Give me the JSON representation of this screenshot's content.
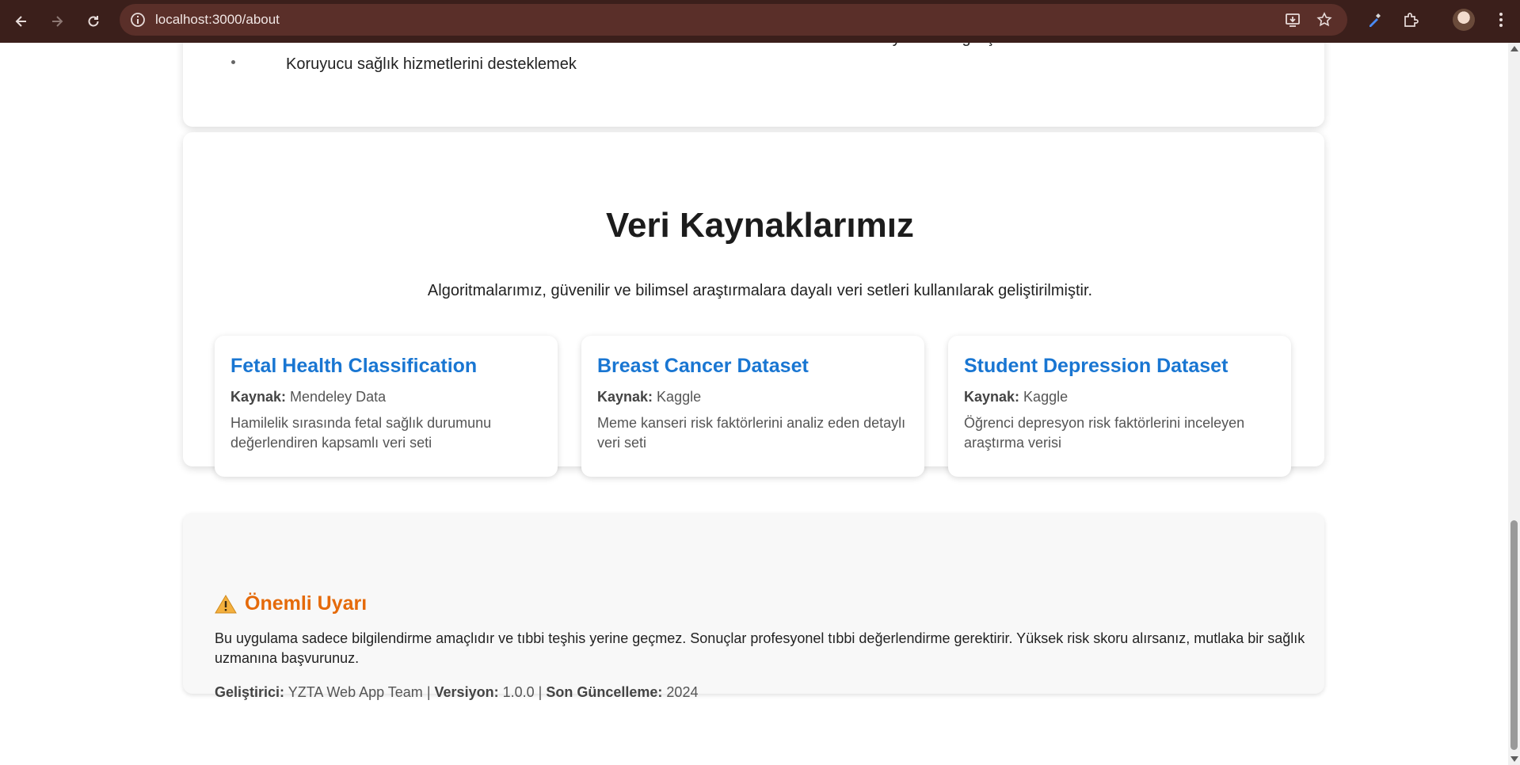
{
  "browser": {
    "url": "localhost:3000/about"
  },
  "top_card": {
    "bullet": "Koruyucu sağlık hizmetlerini desteklemek",
    "cut_text": "Sürekli yenilik ve gelişim"
  },
  "sources": {
    "title": "Veri Kaynaklarımız",
    "subtitle": "Algoritmalarımız, güvenilir ve bilimsel araştırmalara dayalı veri setleri kullanılarak geliştirilmiştir.",
    "source_label": "Kaynak:",
    "items": [
      {
        "title": "Fetal Health Classification",
        "source": "Mendeley Data",
        "desc": "Hamilelik sırasında fetal sağlık durumunu değerlendiren kapsamlı veri seti"
      },
      {
        "title": "Breast Cancer Dataset",
        "source": "Kaggle",
        "desc": "Meme kanseri risk faktörlerini analiz eden detaylı veri seti"
      },
      {
        "title": "Student Depression Dataset",
        "source": "Kaggle",
        "desc": "Öğrenci depresyon risk faktörlerini inceleyen araştırma verisi"
      }
    ]
  },
  "warning": {
    "title": "Önemli Uyarı",
    "text": "Bu uygulama sadece bilgilendirme amaçlıdır ve tıbbi teşhis yerine geçmez. Sonuçlar profesyonel tıbbi değerlendirme gerektirir. Yüksek risk skoru alırsanız, mutlaka bir sağlık uzmanına başvurunuz.",
    "developer_label": "Geliştirici:",
    "developer": "YZTA Web App Team",
    "sep": "|",
    "version_label": "Versiyon:",
    "version": "1.0.0",
    "updated_label": "Son Güncelleme:",
    "updated": "2024"
  },
  "colors": {
    "accent_blue": "#1976d2",
    "warning_orange": "#e56a0a",
    "chrome_bg": "#3b1f1b"
  }
}
